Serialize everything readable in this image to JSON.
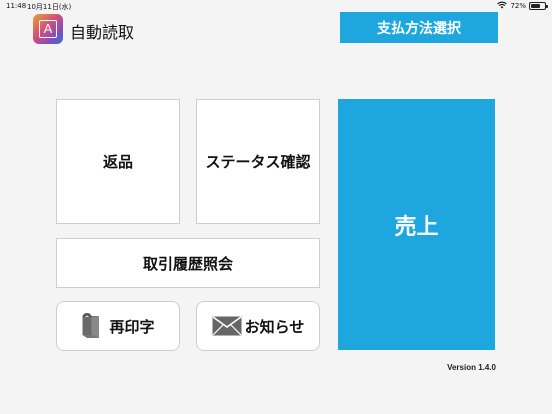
{
  "status_bar": {
    "time": "11:48",
    "date": "10月11日(水)",
    "battery": "72%",
    "battery_level": 0.72
  },
  "header": {
    "logo_letter": "A",
    "title": "自動読取",
    "pay_button": "支払方法選択"
  },
  "tiles": {
    "return": "返品",
    "status": "ステータス確認",
    "history": "取引履歴照会",
    "reprint": "再印字",
    "notice": "お知らせ",
    "sales": "売上"
  },
  "footer": {
    "version": "Version 1.4.0"
  },
  "colors": {
    "accent": "#1ea7de",
    "background": "#f4f4f4"
  }
}
